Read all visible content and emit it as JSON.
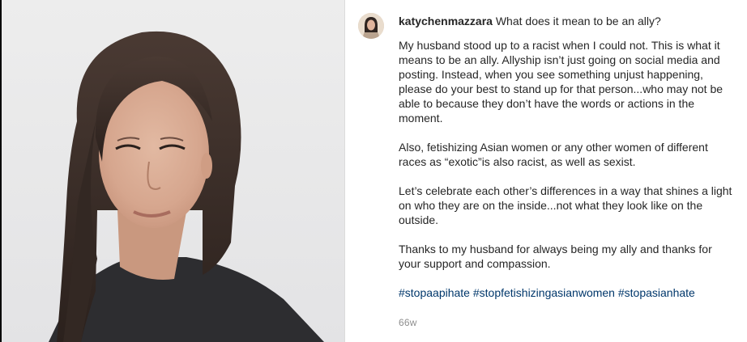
{
  "post": {
    "username": "katychenmazzara",
    "title": "What does it mean to be an ally?",
    "paragraphs": [
      "My husband stood up to a racist when I could not. This is what it means to be an ally. Allyship isn’t just going on social media and posting. Instead, when you see something unjust happening, please do your best to stand up for that person...who may not be able to because they don’t have the words or actions in the moment.",
      "Also, fetishizing Asian women or any other women of different races as “exotic”is also racist, as well as sexist.",
      "Let’s celebrate each other’s differences in a way that shines a light on who they are on the inside...not what they look like on the outside.",
      "Thanks to my husband for always being my ally and thanks for your support and compassion."
    ],
    "hashtags": [
      "#stopaapihate",
      "#stopfetishizingasianwomen",
      "#stopasianhate"
    ],
    "timestamp": "66w"
  },
  "colors": {
    "text": "#262626",
    "hashtag": "#00376b",
    "muted": "#8e8e8e",
    "divider": "#dbdbdb"
  },
  "icons": {
    "avatar": "profile-avatar",
    "photo": "portrait-photo"
  }
}
